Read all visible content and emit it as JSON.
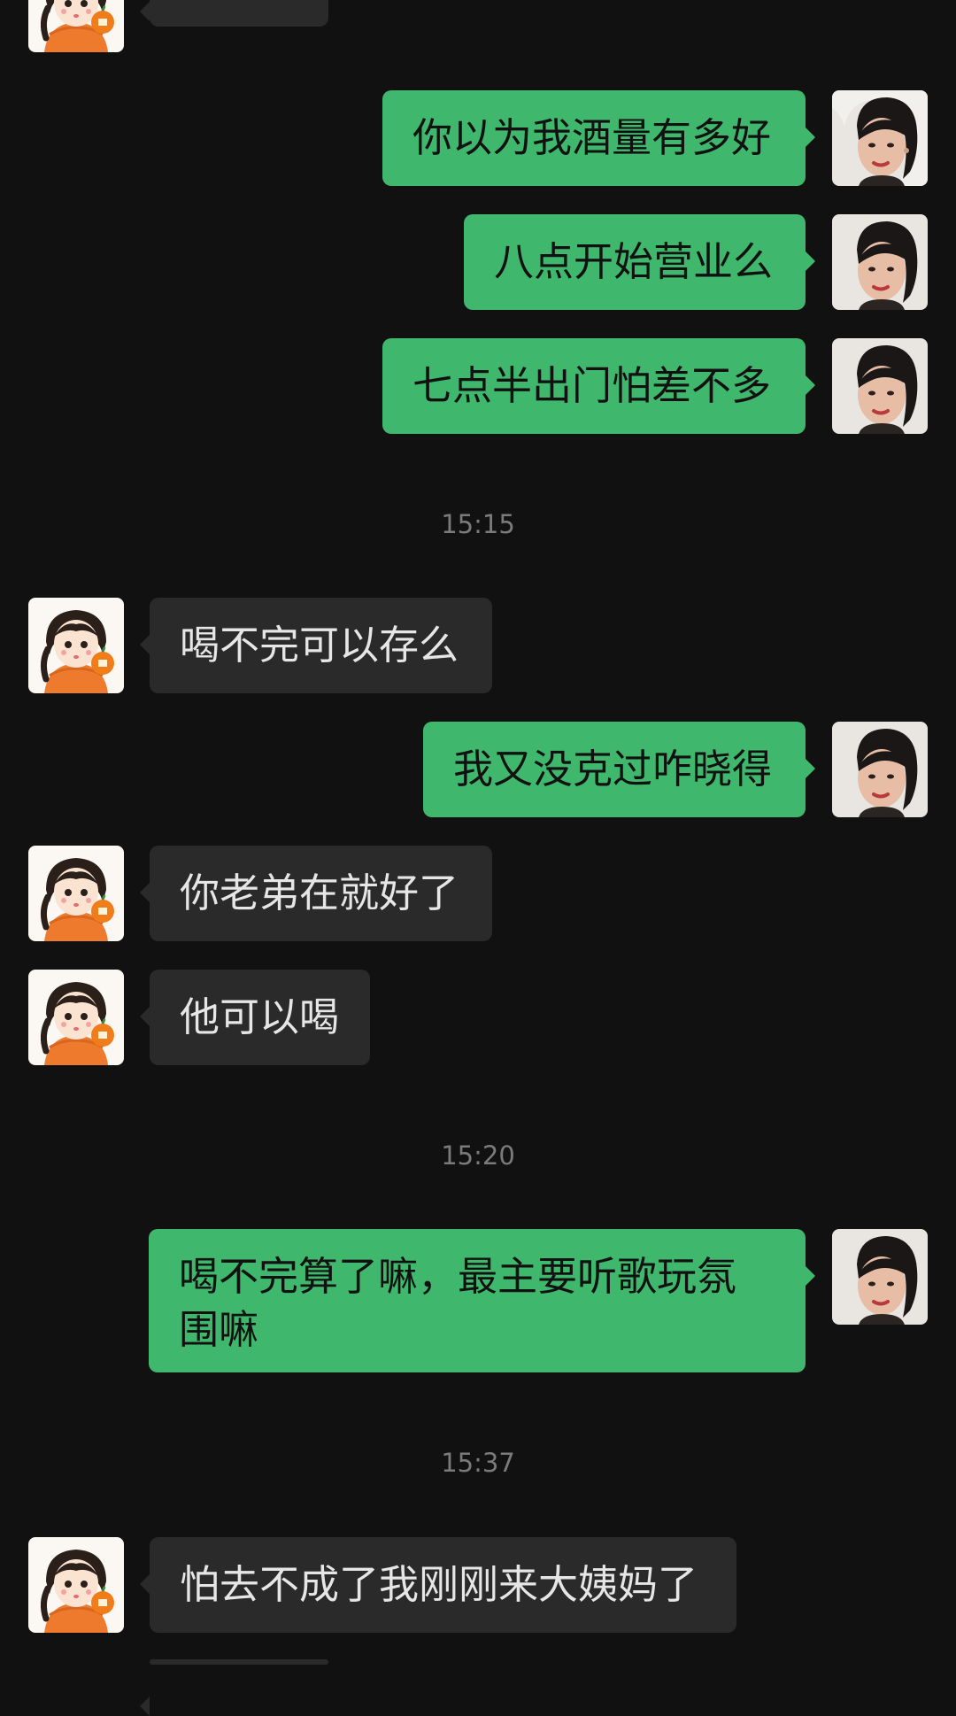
{
  "chat": {
    "messages": [
      {
        "text": "你以为我酒量有多好"
      },
      {
        "text": "八点开始营业么"
      },
      {
        "text": "七点半出门怕差不多"
      },
      {
        "text": "喝不完可以存么"
      },
      {
        "text": "我又没克过咋晓得"
      },
      {
        "text": "你老弟在就好了"
      },
      {
        "text": "他可以喝"
      },
      {
        "text": "喝不完算了嘛，最主要听歌玩氛围嘛"
      },
      {
        "text": "怕去不成了我刚刚来大姨妈了"
      }
    ],
    "timestamps": [
      "15:15",
      "15:20",
      "15:37"
    ]
  },
  "colors": {
    "background": "#111111",
    "outgoing_bubble": "#3fb86d",
    "incoming_bubble": "#2a2a2a",
    "timestamp_text": "#7b7b7b"
  },
  "icons": {
    "incoming_avatar": "girl-with-orange-avatar",
    "outgoing_avatar": "woman-photo-avatar"
  }
}
